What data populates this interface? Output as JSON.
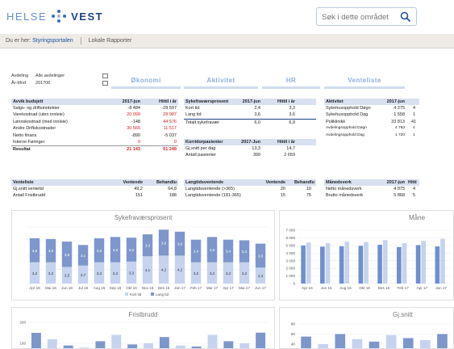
{
  "header": {
    "brand_left": "HELSE",
    "brand_right": "VEST",
    "search_placeholder": "Søk i dette området",
    "search_icon": "search-icon"
  },
  "breadcrumb": {
    "prefix": "Du er her:",
    "items": [
      "Styringsportalen",
      "Lokale Rapporter"
    ]
  },
  "filters": [
    {
      "label": "Avdeling",
      "value": "Alle avdelinger"
    },
    {
      "label": "År-Mnd",
      "value": "201706"
    }
  ],
  "tabs": [
    "Økonomi",
    "Aktivitet",
    "HR",
    "Venteliste"
  ],
  "tables": {
    "economy": {
      "headers": [
        "Avvik budsjett",
        "2017-jun",
        "Hittil i år"
      ],
      "rows": [
        {
          "label": "Salgs- og driftsinntekter",
          "v1": "-8 484",
          "v2": "-28 597",
          "red": [
            false,
            false
          ]
        },
        {
          "label": "Varekostnad (uten innleie)",
          "v1": "20 099",
          "v2": "28 987",
          "red": [
            true,
            true
          ]
        },
        {
          "label": "Lønnskostnad (med innleie)",
          "v1": "-148",
          "v2": "44 576",
          "red": [
            false,
            true
          ]
        },
        {
          "label": "Andre Driftskostnader",
          "v1": "30 565",
          "v2": "11 517",
          "red": [
            true,
            true
          ]
        },
        {
          "label": "Netto finans",
          "v1": "-890",
          "v2": "-5 037",
          "red": [
            false,
            false
          ]
        },
        {
          "label": "Interne Føringer",
          "v1": "0",
          "v2": "0",
          "red": [
            true,
            true
          ]
        }
      ],
      "total": {
        "label": "Resultat",
        "v1": "21 143",
        "v2": "51 249"
      }
    },
    "sickleave": {
      "headers": [
        "Sykefraværsprosent",
        "2017-jun",
        "Hittil i år"
      ],
      "rows": [
        {
          "label": "Kort tid",
          "v1": "2,4",
          "v2": "3,3"
        },
        {
          "label": "Lang tid",
          "v1": "3,6",
          "v2": "3,6"
        },
        {
          "label": "Totalt sykefravær",
          "v1": "6,0",
          "v2": "6,9"
        }
      ]
    },
    "corridor": {
      "headers": [
        "Korridorpasienter",
        "2017-Jun",
        "Hittil i år"
      ],
      "rows": [
        {
          "label": "Gj.snitt per dag",
          "v1": "13,3",
          "v2": "14,7"
        },
        {
          "label": "Antall pasienter",
          "v1": "399",
          "v2": "2 659"
        }
      ]
    },
    "activity": {
      "headers": [
        "Aktivitet",
        "2017-jun",
        ""
      ],
      "rows": [
        {
          "label": "Sykehusopphold Døgn",
          "v1": "4 275",
          "v2": "4"
        },
        {
          "label": "Sykehusopphold Dag",
          "v1": "1 558",
          "v2": "1"
        },
        {
          "label": "Poliklinikk",
          "v1": "33 813",
          "v2": "41"
        },
        {
          "label": "Avdelingsopphold Døgn",
          "v1": "4 793",
          "v2": "4"
        },
        {
          "label": "Avdelingsopphold Dag",
          "v1": "1 720",
          "v2": "1"
        }
      ]
    },
    "waitlist": {
      "headers": [
        "Venteliste",
        "Ventende",
        "Behandlu"
      ],
      "rows": [
        {
          "label": "Gj.snitt ventetid",
          "v1": "49,2",
          "v2": "64,8"
        },
        {
          "label": "Antall Fristbrudd",
          "v1": "151",
          "v2": "188"
        }
      ]
    },
    "longwait": {
      "headers": [
        "Langtidsventende",
        "Ventende",
        "Behandlu"
      ],
      "rows": [
        {
          "label": "Langtidsventende (>365)",
          "v1": "20",
          "v2": "10"
        },
        {
          "label": "Langtidsventende (181-365)",
          "v1": "15",
          "v2": "75"
        }
      ]
    },
    "monthly": {
      "headers": [
        "Månedsverk",
        "2017-jun",
        "Hitti"
      ],
      "rows": [
        {
          "label": "Netto månedsverk",
          "v1": "4 875",
          "v2": "4"
        },
        {
          "label": "Brutto månedsverk",
          "v1": "5 868",
          "v2": "5"
        }
      ]
    }
  },
  "chart_data": [
    {
      "type": "bar",
      "title": "Sykefraværsprosent",
      "categories": [
        "Apr 16",
        "Mai 16",
        "Jun 16",
        "Jul 16",
        "Aug 16",
        "Sep 16",
        "Okt 16",
        "Nov 16",
        "Des 16",
        "Jan 17",
        "Feb 17",
        "Mar 17",
        "Apr 17",
        "Mai 17",
        "Jun 17"
      ],
      "series": [
        {
          "name": "Kort tid",
          "values": [
            3.2,
            3.2,
            2.5,
            2.7,
            3.2,
            3.2,
            3.3,
            4.1,
            4.2,
            4.2,
            3.2,
            3.2,
            3.2,
            3.2,
            2.4
          ]
        },
        {
          "name": "Lang tid",
          "values": [
            3.6,
            3.5,
            3.8,
            3.1,
            3.6,
            3.8,
            3.6,
            3.3,
            3.9,
            3.6,
            3.4,
            3.8,
            3.4,
            3.3,
            3.6
          ]
        }
      ],
      "stacked": true,
      "colors": [
        "#c5d3ee",
        "#7d97cc"
      ]
    },
    {
      "type": "bar",
      "title": "Måne",
      "ytick_labels": [
        "7 000",
        "6 000",
        "5 000",
        "4 000",
        "3 000",
        "2 000",
        "1 000",
        "0"
      ],
      "ylim": [
        0,
        7000
      ],
      "categories": [
        "Apr 16",
        "Jun 16",
        "Aug 16",
        "Okt 16",
        "Des 16",
        "Feb 17",
        "Apr 17",
        "Jun 17"
      ],
      "series": [
        {
          "name": "Netto",
          "values": [
            5000,
            4850,
            4900,
            4950,
            5100,
            4800,
            5050,
            4875
          ]
        },
        {
          "name": "Brutto",
          "values": [
            5400,
            5300,
            5500,
            5450,
            5700,
            5300,
            5600,
            5868
          ]
        }
      ],
      "colors": [
        "#6f8fd0",
        "#c5d3ee"
      ]
    },
    {
      "type": "bar",
      "title": "Fristbrudd",
      "ytick_labels": [
        "200",
        "100"
      ],
      "ylim": [
        0,
        200
      ],
      "values": [
        150,
        120,
        90,
        80,
        110,
        140,
        95,
        100,
        130,
        90,
        85,
        140,
        110,
        100,
        151
      ]
    },
    {
      "type": "bar",
      "title": "Gj.snitt",
      "ytick_labels": [
        "80",
        "60",
        "40"
      ],
      "ylim": [
        0,
        80
      ],
      "values": [
        55,
        40,
        60,
        50,
        45,
        58,
        52,
        48,
        60
      ]
    }
  ]
}
